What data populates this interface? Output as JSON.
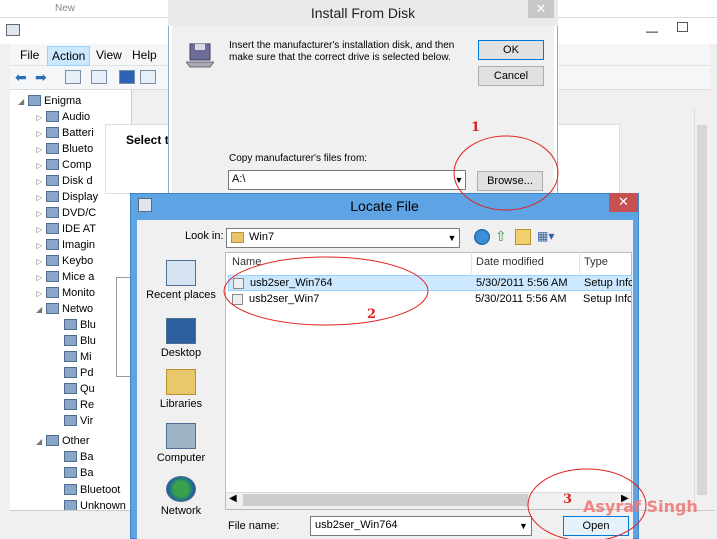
{
  "background": {
    "new_label": "New",
    "menu": [
      "File",
      "Action",
      "View",
      "Help"
    ],
    "tree": {
      "root": "Enigma",
      "items": [
        "Audio",
        "Batteri",
        "Blueto",
        "Comp",
        "Disk d",
        "Display",
        "DVD/C",
        "IDE AT",
        "Imagin",
        "Keybo",
        "Mice a",
        "Monito",
        "Netwo",
        "Blu",
        "Blu",
        "Mi",
        "Pd",
        "Qu",
        "Re",
        "Vir",
        "Other",
        "Ba",
        "Ba",
        "Bluetoot",
        "Unknown"
      ]
    },
    "panel_heading": "Select t"
  },
  "install_from_disk": {
    "title": "Install From Disk",
    "close": "✕",
    "message": "Insert the manufacturer's installation disk, and then make sure that the correct drive is selected below.",
    "ok": "OK",
    "cancel": "Cancel",
    "copy_label": "Copy manufacturer's files from:",
    "path_value": "A:\\",
    "browse": "Browse..."
  },
  "locate_file": {
    "title": "Locate File",
    "close": "✕",
    "look_in_label": "Look in:",
    "look_in_value": "Win7",
    "places": [
      "Recent places",
      "Desktop",
      "Libraries",
      "Computer",
      "Network"
    ],
    "columns": [
      "Name",
      "Date modified",
      "Type"
    ],
    "rows": [
      {
        "name": "usb2ser_Win764",
        "date": "5/30/2011 5:56 AM",
        "type": "Setup Infc"
      },
      {
        "name": "usb2ser_Win7",
        "date": "5/30/2011 5:56 AM",
        "type": "Setup Infc"
      }
    ],
    "file_name_label": "File name:",
    "file_name_value": "usb2ser_Win764",
    "open": "Open"
  },
  "annotations": {
    "n1": "1",
    "n2": "2",
    "n3": "3",
    "watermark": "Asyraf Singh",
    "color": "#e02020"
  }
}
